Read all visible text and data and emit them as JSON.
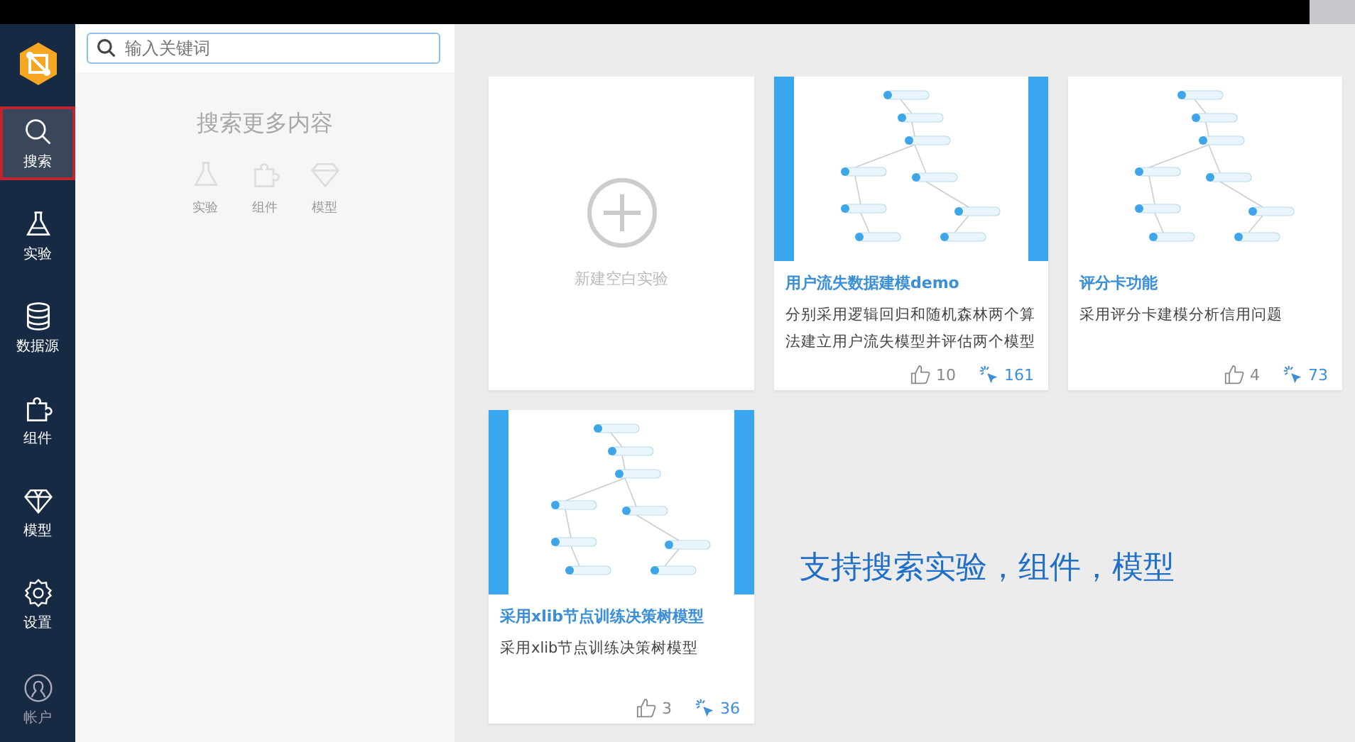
{
  "sidebar": {
    "items": [
      {
        "kind": "search",
        "label": "搜索",
        "selected": true
      },
      {
        "kind": "flask",
        "label": "实验",
        "selected": false
      },
      {
        "kind": "database",
        "label": "数据源",
        "selected": false
      },
      {
        "kind": "puzzle",
        "label": "组件",
        "selected": false
      },
      {
        "kind": "diamond",
        "label": "模型",
        "selected": false
      },
      {
        "kind": "gear",
        "label": "设置",
        "selected": false
      }
    ],
    "account": {
      "label": "帐户"
    }
  },
  "search_panel": {
    "placeholder": "输入关键词",
    "heading": "搜索更多内容",
    "categories": [
      {
        "kind": "flask",
        "label": "实验"
      },
      {
        "kind": "puzzle",
        "label": "组件"
      },
      {
        "kind": "diamond",
        "label": "模型"
      }
    ]
  },
  "new_experiment": {
    "label": "新建空白实验"
  },
  "cards": [
    {
      "title": "用户流失数据建模demo",
      "description": "分别采用逻辑回归和随机森林两个算法建立用户流失模型并评估两个模型",
      "likes": "10",
      "views": "161",
      "highlighted": true
    },
    {
      "title": "评分卡功能",
      "description": "采用评分卡建模分析信用问题",
      "likes": "4",
      "views": "73",
      "highlighted": false
    },
    {
      "title": "采用xlib节点训练决策树模型",
      "description": "采用xlib节点训练决策树模型",
      "likes": "3",
      "views": "36",
      "highlighted": true
    }
  ],
  "caption": "支持搜索实验，组件，模型"
}
